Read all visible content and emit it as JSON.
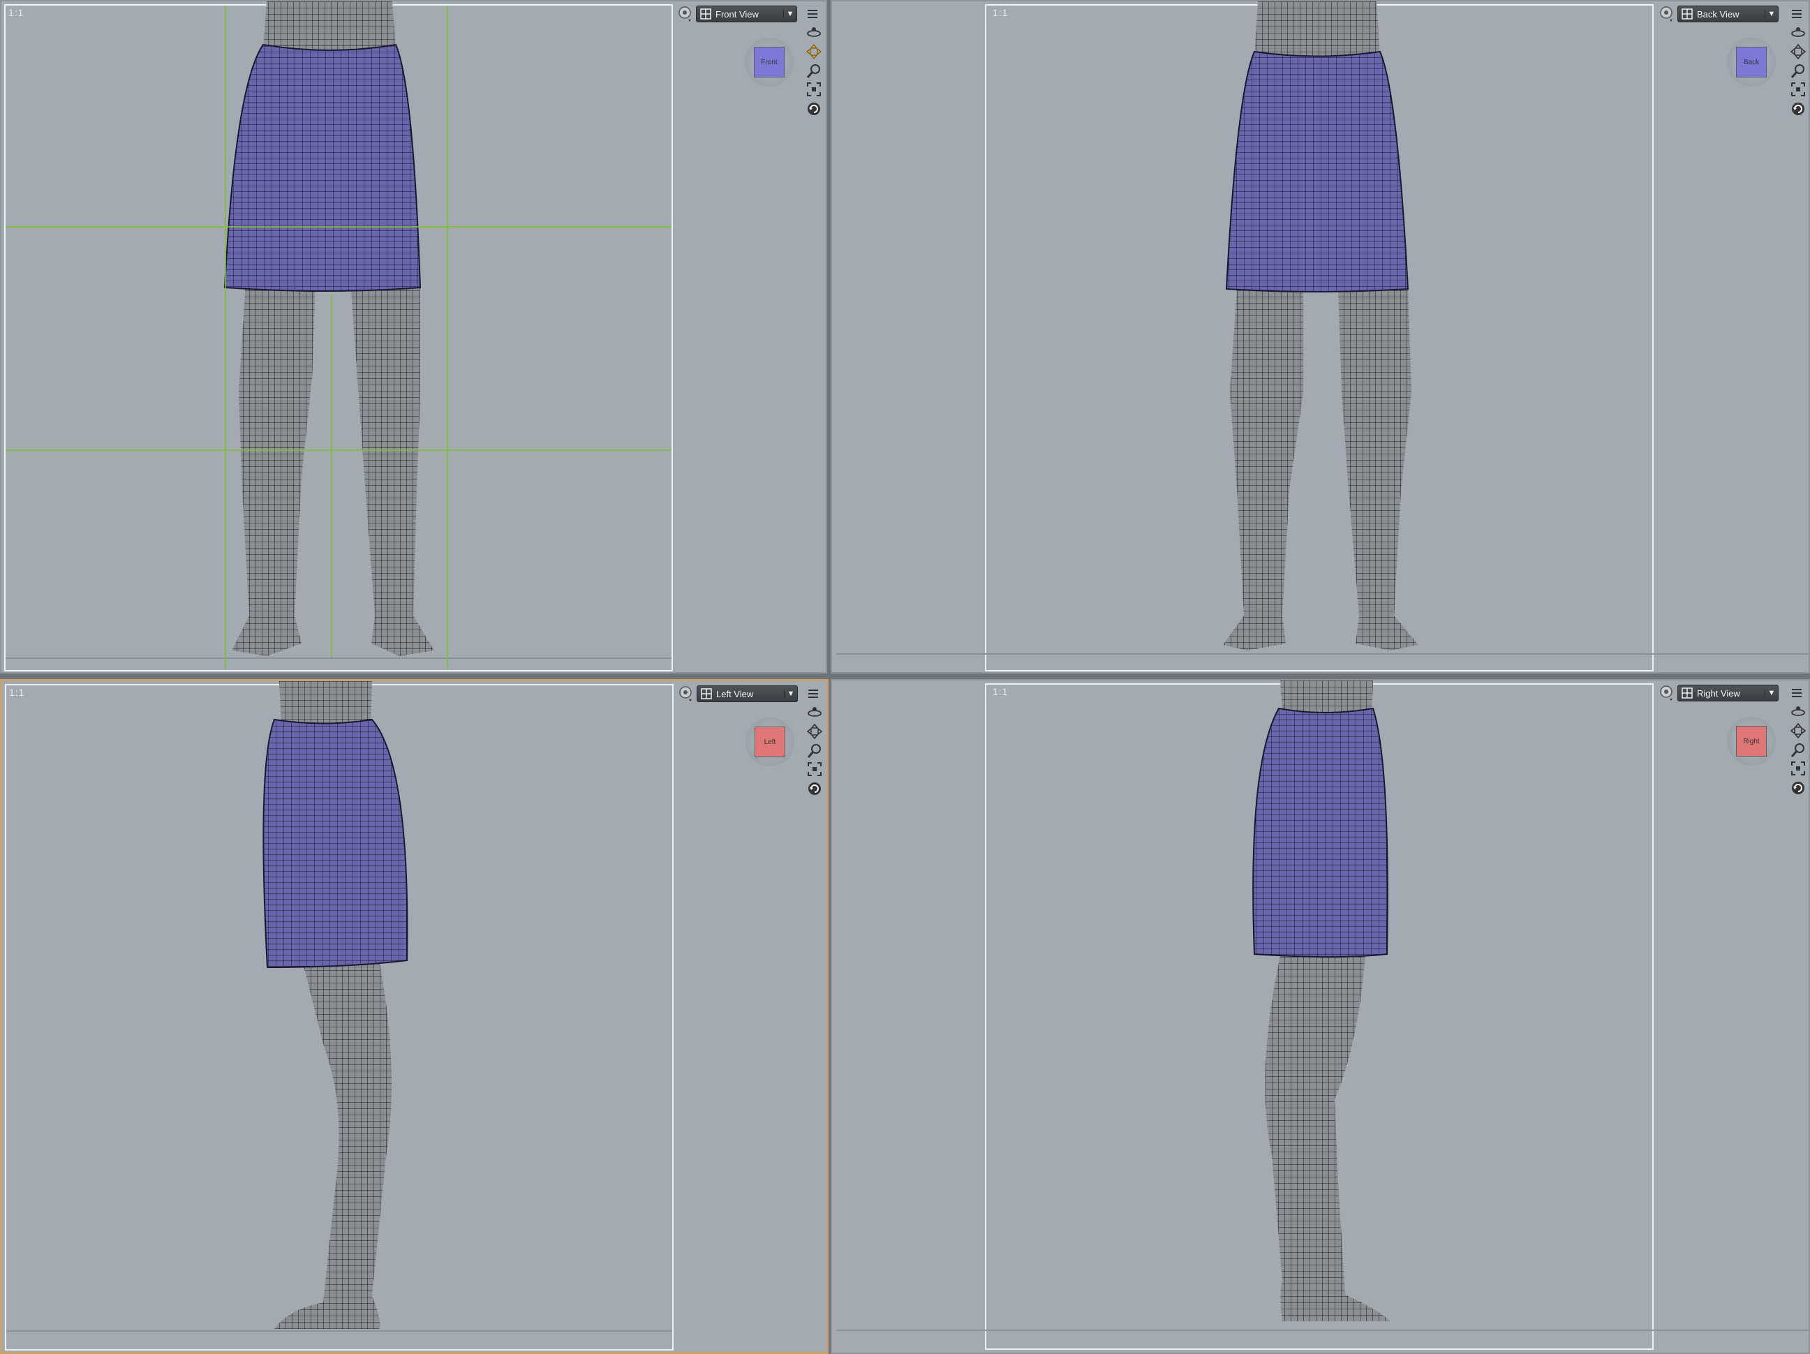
{
  "viewports": [
    {
      "id": "front",
      "view_label": "Front View",
      "aspect": "1:1",
      "cube_label": "Front",
      "cube_color": "#7b78d8",
      "active": false
    },
    {
      "id": "back",
      "view_label": "Back View",
      "aspect": "1:1",
      "cube_label": "Back",
      "cube_color": "#7b78d8",
      "active": false
    },
    {
      "id": "left",
      "view_label": "Left View",
      "aspect": "1:1",
      "cube_label": "Left",
      "cube_color": "#e07676",
      "active": true
    },
    {
      "id": "right",
      "view_label": "Right View",
      "aspect": "1:1",
      "cube_label": "Right",
      "cube_color": "#e07676",
      "active": false
    }
  ],
  "icons": {
    "camera": "camera-icon",
    "menu": "viewport-menu-icon",
    "orbit": "orbit-icon",
    "pan": "pan-icon",
    "zoom": "zoom-icon",
    "frame": "frame-icon",
    "reset": "reset-view-icon"
  },
  "colors": {
    "viewport_bg": "#a3aab1",
    "skirt": "#5e5a9c",
    "skin_wire": "#3a3a3a",
    "guide": "#7fbf3a",
    "active_border": "#c9a26b"
  }
}
